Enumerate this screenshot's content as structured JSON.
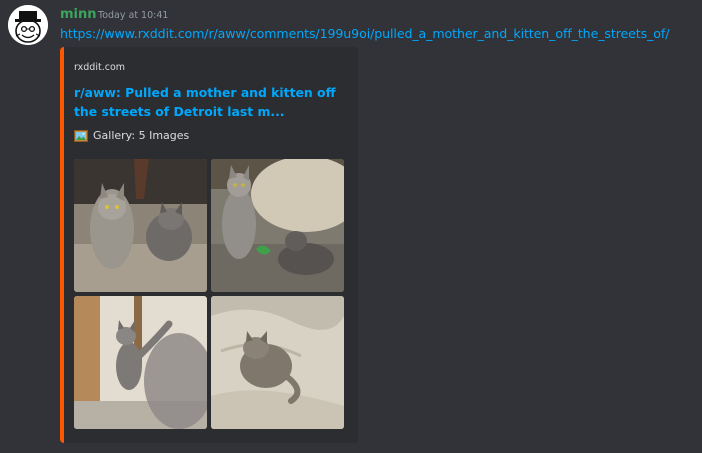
{
  "message": {
    "username": "minn",
    "timestamp": "Today at 10:41",
    "link": "https://www.rxddit.com/r/aww/comments/199u9oi/pulled_a_mother_and_kitten_off_the_streets_of/"
  },
  "embed": {
    "provider": "rxddit.com",
    "title": "r/aww: Pulled a mother and kitten off the streets of Detroit last m...",
    "gallery_label": "Gallery: 5 Images",
    "accent_color": "#ff5700",
    "link_color": "#00a8fc",
    "images": [
      {
        "icon": "photo-cats-on-rug"
      },
      {
        "icon": "photo-cats-by-pouf"
      },
      {
        "icon": "photo-cat-jumping"
      },
      {
        "icon": "photo-cat-on-blanket"
      }
    ]
  },
  "colors": {
    "background": "#313338",
    "embed_background": "#2b2d31",
    "username": "#3ba55d"
  }
}
